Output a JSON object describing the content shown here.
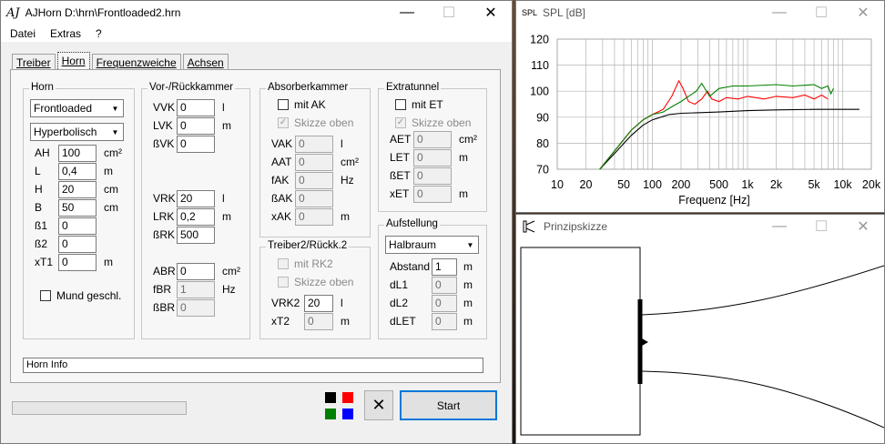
{
  "main_window": {
    "icon": "AJ",
    "title": "AJHorn  D:\\hrn\\Frontloaded2.hrn",
    "menu": [
      "Datei",
      "Extras",
      "?"
    ],
    "tabs": [
      "Treiber",
      "Horn",
      "Frequenzweiche",
      "Achsen"
    ],
    "active_tab": "Horn",
    "horn": {
      "group": "Horn",
      "type": "Frontloaded",
      "profile": "Hyperbolisch",
      "fields": [
        {
          "label": "AH",
          "value": "100",
          "unit": "cm²"
        },
        {
          "label": "L",
          "value": "0,4",
          "unit": "m"
        },
        {
          "label": "H",
          "value": "20",
          "unit": "cm"
        },
        {
          "label": "B",
          "value": "50",
          "unit": "cm"
        },
        {
          "label": "ß1",
          "value": "0",
          "unit": ""
        },
        {
          "label": "ß2",
          "value": "0",
          "unit": ""
        },
        {
          "label": "xT1",
          "value": "0",
          "unit": "m"
        }
      ],
      "mund_label": "Mund geschl."
    },
    "kammer": {
      "group": "Vor-/Rückkammer",
      "top": [
        {
          "label": "VVK",
          "value": "0",
          "unit": "l"
        },
        {
          "label": "LVK",
          "value": "0",
          "unit": "m"
        },
        {
          "label": "ßVK",
          "value": "0",
          "unit": ""
        }
      ],
      "mid": [
        {
          "label": "VRK",
          "value": "20",
          "unit": "l"
        },
        {
          "label": "LRK",
          "value": "0,2",
          "unit": "m"
        },
        {
          "label": "ßRK",
          "value": "500",
          "unit": ""
        }
      ],
      "bot": [
        {
          "label": "ABR",
          "value": "0",
          "unit": "cm²",
          "ro": false
        },
        {
          "label": "fBR",
          "value": "1",
          "unit": "Hz",
          "ro": true
        },
        {
          "label": "ßBR",
          "value": "0",
          "unit": "",
          "ro": true
        }
      ]
    },
    "absorber": {
      "group": "Absorberkammer",
      "mit_label": "mit AK",
      "skizze_label": "Skizze oben",
      "fields": [
        {
          "label": "VAK",
          "value": "0",
          "unit": "l"
        },
        {
          "label": "AAT",
          "value": "0",
          "unit": "cm²"
        },
        {
          "label": "fAK",
          "value": "0",
          "unit": "Hz"
        },
        {
          "label": "ßAK",
          "value": "0",
          "unit": ""
        },
        {
          "label": "xAK",
          "value": "0",
          "unit": "m"
        }
      ]
    },
    "extratunnel": {
      "group": "Extratunnel",
      "mit_label": "mit ET",
      "skizze_label": "Skizze oben",
      "fields": [
        {
          "label": "AET",
          "value": "0",
          "unit": "cm²"
        },
        {
          "label": "LET",
          "value": "0",
          "unit": "m"
        },
        {
          "label": "ßET",
          "value": "0",
          "unit": ""
        },
        {
          "label": "xET",
          "value": "0",
          "unit": "m"
        }
      ]
    },
    "treiber2": {
      "group": "Treiber2/Rückk.2",
      "mit_label": "mit RK2",
      "skizze_label": "Skizze oben",
      "fields": [
        {
          "label": "VRK2",
          "value": "20",
          "unit": "l"
        },
        {
          "label": "xT2",
          "value": "0",
          "unit": "m"
        }
      ]
    },
    "aufstellung": {
      "group": "Aufstellung",
      "mode": "Halbraum",
      "fields": [
        {
          "label": "Abstand",
          "value": "1",
          "unit": "m",
          "ro": false
        },
        {
          "label": "dL1",
          "value": "0",
          "unit": "m",
          "ro": true
        },
        {
          "label": "dL2",
          "value": "0",
          "unit": "m",
          "ro": true
        },
        {
          "label": "dLET",
          "value": "0",
          "unit": "m",
          "ro": true
        }
      ]
    },
    "info": "Horn Info",
    "start_label": "Start",
    "clear_symbol": "✕",
    "colors": [
      "#000000",
      "#ff0000",
      "#008000",
      "#0000ff"
    ]
  },
  "spl_window": {
    "icon": "SPL",
    "title": "SPL [dB]"
  },
  "chart_data": {
    "type": "line",
    "title": "",
    "xlabel": "Frequenz [Hz]",
    "ylabel": "",
    "x_scale": "log",
    "xlim": [
      10,
      20000
    ],
    "ylim": [
      70,
      120
    ],
    "x_ticks": [
      10,
      20,
      50,
      100,
      200,
      500,
      1000,
      2000,
      5000,
      10000,
      20000
    ],
    "x_tick_labels": [
      "10",
      "20",
      "50",
      "100",
      "200",
      "500",
      "1k",
      "2k",
      "5k",
      "10k",
      "20k"
    ],
    "y_ticks": [
      70,
      80,
      90,
      100,
      110,
      120
    ],
    "grid": true,
    "series": [
      {
        "color": "#000000",
        "points": [
          [
            28,
            70
          ],
          [
            40,
            76
          ],
          [
            60,
            83
          ],
          [
            80,
            87
          ],
          [
            100,
            89
          ],
          [
            150,
            91
          ],
          [
            200,
            91.5
          ],
          [
            500,
            92
          ],
          [
            1000,
            92.5
          ],
          [
            2000,
            92.8
          ],
          [
            5000,
            93
          ],
          [
            10000,
            93
          ],
          [
            15000,
            93
          ]
        ]
      },
      {
        "color": "#ff0000",
        "points": [
          [
            28,
            70
          ],
          [
            40,
            77
          ],
          [
            60,
            85
          ],
          [
            80,
            89
          ],
          [
            100,
            91
          ],
          [
            130,
            93
          ],
          [
            160,
            98
          ],
          [
            190,
            104
          ],
          [
            210,
            101
          ],
          [
            240,
            96
          ],
          [
            280,
            95
          ],
          [
            330,
            97
          ],
          [
            380,
            100
          ],
          [
            420,
            97
          ],
          [
            500,
            96
          ],
          [
            600,
            97.5
          ],
          [
            800,
            97
          ],
          [
            1000,
            98
          ],
          [
            1500,
            97
          ],
          [
            2000,
            98
          ],
          [
            3000,
            97.5
          ],
          [
            4000,
            98.5
          ],
          [
            5000,
            97
          ],
          [
            6000,
            98.5
          ],
          [
            7000,
            97
          ]
        ]
      },
      {
        "color": "#008000",
        "points": [
          [
            28,
            70
          ],
          [
            40,
            77
          ],
          [
            60,
            85
          ],
          [
            80,
            89
          ],
          [
            100,
            91
          ],
          [
            130,
            92
          ],
          [
            160,
            94
          ],
          [
            200,
            96
          ],
          [
            240,
            98
          ],
          [
            290,
            100
          ],
          [
            330,
            103
          ],
          [
            400,
            98
          ],
          [
            500,
            101
          ],
          [
            700,
            102
          ],
          [
            1000,
            102
          ],
          [
            2000,
            102.5
          ],
          [
            3000,
            102
          ],
          [
            5000,
            102.5
          ],
          [
            6000,
            101
          ],
          [
            7000,
            102
          ],
          [
            7500,
            99
          ],
          [
            8000,
            101
          ]
        ]
      }
    ]
  },
  "sketch_window": {
    "title": "Prinzipskizze"
  }
}
